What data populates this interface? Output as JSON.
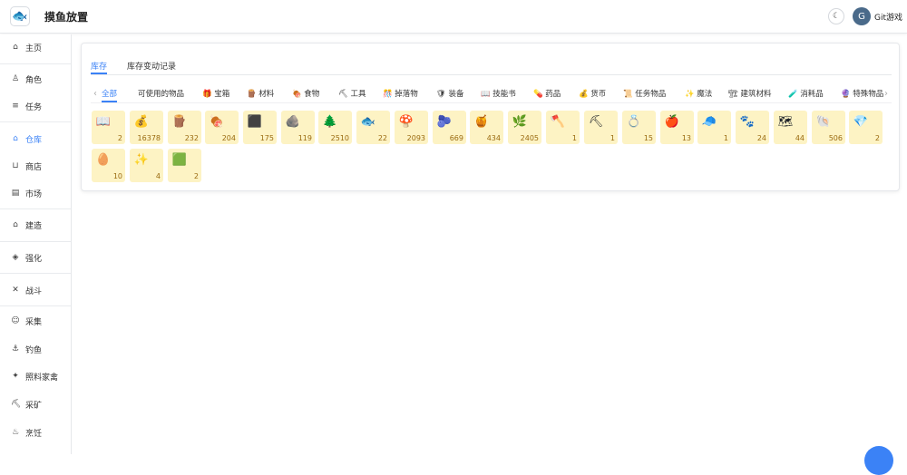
{
  "app": {
    "title": "摸鱼放置",
    "logo_glyph": "🐟"
  },
  "header": {
    "theme_glyph": "☾",
    "avatar_glyph": "G",
    "user_name": "Git游戏"
  },
  "sidebar": {
    "items": [
      {
        "label": "主页",
        "icon": "home-icon",
        "glyph": "⌂"
      },
      {
        "label": "角色",
        "icon": "person-icon",
        "glyph": "♙"
      },
      {
        "label": "任务",
        "icon": "list-icon",
        "glyph": "≡"
      },
      {
        "label": "仓库",
        "icon": "warehouse-icon",
        "glyph": "⌂",
        "active": true
      },
      {
        "label": "商店",
        "icon": "basket-icon",
        "glyph": "⊔"
      },
      {
        "label": "市场",
        "icon": "market-icon",
        "glyph": "▤"
      },
      {
        "label": "建造",
        "icon": "build-icon",
        "glyph": "⌂"
      },
      {
        "label": "强化",
        "icon": "upgrade-icon",
        "glyph": "◈"
      },
      {
        "label": "战斗",
        "icon": "swords-icon",
        "glyph": "✕"
      },
      {
        "label": "采集",
        "icon": "gather-icon",
        "glyph": "☺"
      },
      {
        "label": "钓鱼",
        "icon": "fishing-icon",
        "glyph": "⚓"
      },
      {
        "label": "照料家禽",
        "icon": "poultry-icon",
        "glyph": "✦"
      },
      {
        "label": "采矿",
        "icon": "mining-icon",
        "glyph": "⛏"
      },
      {
        "label": "烹饪",
        "icon": "cooking-icon",
        "glyph": "♨"
      }
    ]
  },
  "tabs": [
    {
      "label": "库存",
      "active": true
    },
    {
      "label": "库存变动记录"
    }
  ],
  "categories": [
    {
      "label": "全部",
      "active": true
    },
    {
      "label": "可使用的物品"
    },
    {
      "label": "🎁 宝箱"
    },
    {
      "label": "🪵 材料"
    },
    {
      "label": "🍖 食物"
    },
    {
      "label": "⛏ 工具"
    },
    {
      "label": "🎊 掉落物"
    },
    {
      "label": "🛡 装备"
    },
    {
      "label": "📖 技能书"
    },
    {
      "label": "💊 药品"
    },
    {
      "label": "💰 货币"
    },
    {
      "label": "📜 任务物品"
    },
    {
      "label": "✨ 魔法"
    },
    {
      "label": "🏗 建筑材料"
    },
    {
      "label": "🧪 消耗品"
    },
    {
      "label": "🔮 特殊物品"
    }
  ],
  "inventory": [
    {
      "name": "book",
      "glyph": "📖",
      "count": "2"
    },
    {
      "name": "money-bag",
      "glyph": "💰",
      "count": "16378"
    },
    {
      "name": "wood",
      "glyph": "🪵",
      "count": "232"
    },
    {
      "name": "meat",
      "glyph": "🍖",
      "count": "204"
    },
    {
      "name": "coal",
      "glyph": "⬛",
      "count": "175"
    },
    {
      "name": "ore",
      "glyph": "🪨",
      "count": "119"
    },
    {
      "name": "herb",
      "glyph": "🌲",
      "count": "2510"
    },
    {
      "name": "fish",
      "glyph": "🐟",
      "count": "22"
    },
    {
      "name": "mushroom",
      "glyph": "🍄",
      "count": "2093"
    },
    {
      "name": "berry",
      "glyph": "🫐",
      "count": "669"
    },
    {
      "name": "honey",
      "glyph": "🍯",
      "count": "434"
    },
    {
      "name": "leaf",
      "glyph": "🌿",
      "count": "2405"
    },
    {
      "name": "axe",
      "glyph": "🪓",
      "count": "1"
    },
    {
      "name": "pickaxe",
      "glyph": "⛏",
      "count": "1"
    },
    {
      "name": "ring",
      "glyph": "💍",
      "count": "15"
    },
    {
      "name": "apple",
      "glyph": "🍎",
      "count": "13"
    },
    {
      "name": "cap",
      "glyph": "🧢",
      "count": "1"
    },
    {
      "name": "paw",
      "glyph": "🐾",
      "count": "24"
    },
    {
      "name": "map",
      "glyph": "🗺",
      "count": "44"
    },
    {
      "name": "shell",
      "glyph": "🐚",
      "count": "506"
    },
    {
      "name": "gem",
      "glyph": "💎",
      "count": "2"
    },
    {
      "name": "seed",
      "glyph": "🥚",
      "count": "10"
    },
    {
      "name": "sparkle",
      "glyph": "✨",
      "count": "4"
    },
    {
      "name": "green-block",
      "glyph": "🟩",
      "count": "2"
    }
  ],
  "colors": {
    "accent": "#3b82f6",
    "slot_bg": "#fdf3c4",
    "count_text": "#9a6a10"
  }
}
